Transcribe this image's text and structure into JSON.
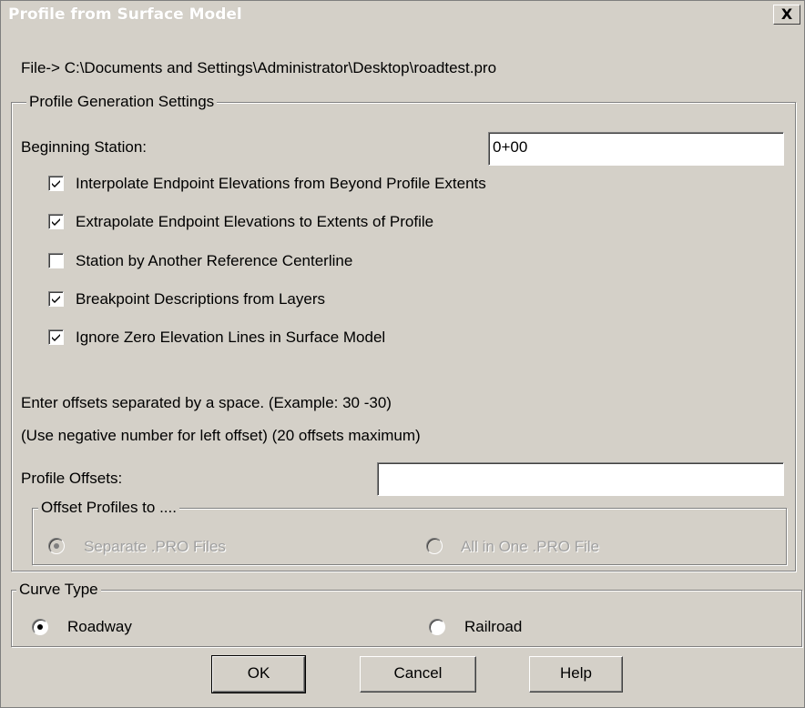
{
  "window": {
    "title": "Profile from Surface Model",
    "close_glyph": "X"
  },
  "file_path": "File-> C:\\Documents and Settings\\Administrator\\Desktop\\roadtest.pro",
  "profile_settings": {
    "group_label": "Profile Generation Settings",
    "beginning_station_label": "Beginning Station:",
    "beginning_station_value": "0+00",
    "options": [
      {
        "label": "Interpolate Endpoint Elevations from Beyond Profile Extents",
        "checked": true
      },
      {
        "label": "Extrapolate Endpoint Elevations to Extents of Profile",
        "checked": true
      },
      {
        "label": "Station by Another Reference Centerline",
        "checked": false
      },
      {
        "label": "Breakpoint Descriptions from Layers",
        "checked": true
      },
      {
        "label": "Ignore Zero Elevation Lines in Surface Model",
        "checked": true
      }
    ],
    "offset_instructions_1": "Enter offsets separated by a space. (Example: 30 -30)",
    "offset_instructions_2": "(Use negative number for left offset) (20 offsets maximum)",
    "profile_offsets_label": "Profile Offsets:",
    "profile_offsets_value": "",
    "offset_profiles": {
      "group_label": "Offset Profiles to ....",
      "options": [
        {
          "label": "Separate .PRO Files",
          "selected": true,
          "enabled": false
        },
        {
          "label": "All in One .PRO File",
          "selected": false,
          "enabled": false
        }
      ]
    }
  },
  "curve_type": {
    "group_label": "Curve Type",
    "options": [
      {
        "label": "Roadway",
        "selected": true
      },
      {
        "label": "Railroad",
        "selected": false
      }
    ]
  },
  "buttons": {
    "ok": "OK",
    "cancel": "Cancel",
    "help": "Help"
  }
}
